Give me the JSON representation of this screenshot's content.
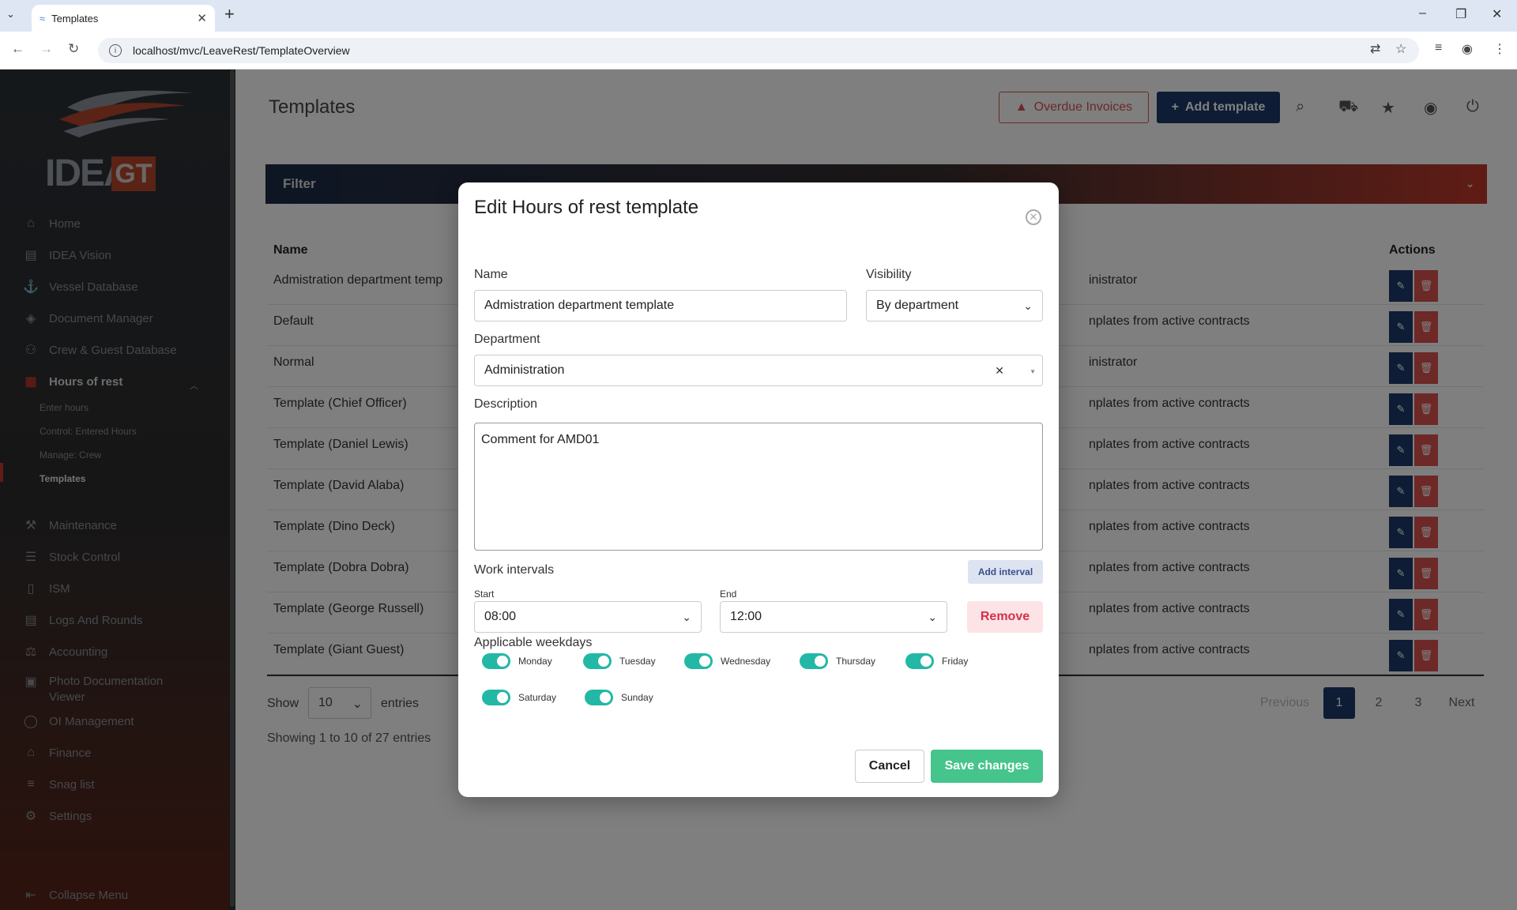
{
  "browser": {
    "tab_title": "Templates",
    "url": "localhost/mvc/LeaveRest/TemplateOverview"
  },
  "sidebar": {
    "logo_text": "IDEA",
    "logo_badge": "GT",
    "items": [
      {
        "label": "Home",
        "icon": "home-icon",
        "glyph": "⌂"
      },
      {
        "label": "IDEA Vision",
        "icon": "clipboard-icon",
        "glyph": "▤"
      },
      {
        "label": "Vessel Database",
        "icon": "anchor-icon",
        "glyph": "⚓"
      },
      {
        "label": "Document Manager",
        "icon": "layers-icon",
        "glyph": "◈"
      },
      {
        "label": "Crew & Guest Database",
        "icon": "users-icon",
        "glyph": "⚇"
      },
      {
        "label": "Hours of rest",
        "icon": "calendar-icon",
        "glyph": "▦"
      }
    ],
    "sub_items": [
      {
        "label": "Enter hours"
      },
      {
        "label": "Control: Entered Hours"
      },
      {
        "label": "Manage: Crew"
      },
      {
        "label": "Templates"
      }
    ],
    "items2": [
      {
        "label": "Maintenance",
        "icon": "wrench-icon",
        "glyph": "⚒"
      },
      {
        "label": "Stock Control",
        "icon": "sliders-icon",
        "glyph": "☰"
      },
      {
        "label": "ISM",
        "icon": "document-icon",
        "glyph": "▯"
      },
      {
        "label": "Logs And Rounds",
        "icon": "log-icon",
        "glyph": "▤"
      },
      {
        "label": "Accounting",
        "icon": "scale-icon",
        "glyph": "⚖"
      },
      {
        "label": "Photo Documentation",
        "label2": "Viewer",
        "icon": "photo-icon",
        "glyph": "▣"
      },
      {
        "label": "OI Management",
        "icon": "bulb-icon",
        "glyph": "◯"
      },
      {
        "label": "Finance",
        "icon": "bank-icon",
        "glyph": "⌂"
      },
      {
        "label": "Snag list",
        "icon": "list-icon",
        "glyph": "≡"
      },
      {
        "label": "Settings",
        "icon": "gear-icon",
        "glyph": "⚙"
      },
      {
        "label": "Collapse Menu",
        "icon": "collapse-icon",
        "glyph": "⇤"
      }
    ]
  },
  "header": {
    "title": "Templates",
    "overdue_label": "Overdue Invoices",
    "add_label": "Add template"
  },
  "filter": {
    "label": "Filter"
  },
  "table": {
    "col_name": "Name",
    "col_actions": "Actions",
    "rows": [
      {
        "name": "Admistration department temp",
        "right": "inistrator"
      },
      {
        "name": "Default",
        "right": "nplates from active contracts"
      },
      {
        "name": "Normal",
        "right": "inistrator"
      },
      {
        "name": "Template (Chief Officer)",
        "right": "nplates from active contracts"
      },
      {
        "name": "Template (Daniel Lewis)",
        "right": "nplates from active contracts"
      },
      {
        "name": "Template (David Alaba)",
        "right": "nplates from active contracts"
      },
      {
        "name": "Template (Dino Deck)",
        "right": "nplates from active contracts"
      },
      {
        "name": "Template (Dobra Dobra)",
        "right": "nplates from active contracts"
      },
      {
        "name": "Template (George Russell)",
        "right": "nplates from active contracts"
      },
      {
        "name": "Template (Giant Guest)",
        "right": "nplates from active contracts"
      }
    ],
    "show_label": "Show",
    "show_value": "10",
    "entries_label": "entries",
    "showing_text": "Showing 1 to 10 of 27 entries",
    "pager": {
      "previous": "Previous",
      "pages": [
        "1",
        "2",
        "3"
      ],
      "next": "Next"
    }
  },
  "modal": {
    "title": "Edit Hours of rest template",
    "name_label": "Name",
    "name_value": "Admistration department template",
    "visibility_label": "Visibility",
    "visibility_value": "By department",
    "department_label": "Department",
    "department_value": "Administration",
    "description_label": "Description",
    "description_value": "Comment for AMD01",
    "work_intervals_label": "Work intervals",
    "add_interval_label": "Add interval",
    "start_label": "Start",
    "start_value": "08:00",
    "end_label": "End",
    "end_value": "12:00",
    "remove_label": "Remove",
    "weekdays_label": "Applicable weekdays",
    "weekdays": [
      "Monday",
      "Tuesday",
      "Wednesday",
      "Thursday",
      "Friday",
      "Saturday",
      "Sunday"
    ],
    "weekdays_on": [
      true,
      true,
      true,
      true,
      true,
      true,
      true
    ],
    "cancel_label": "Cancel",
    "save_label": "Save changes"
  }
}
